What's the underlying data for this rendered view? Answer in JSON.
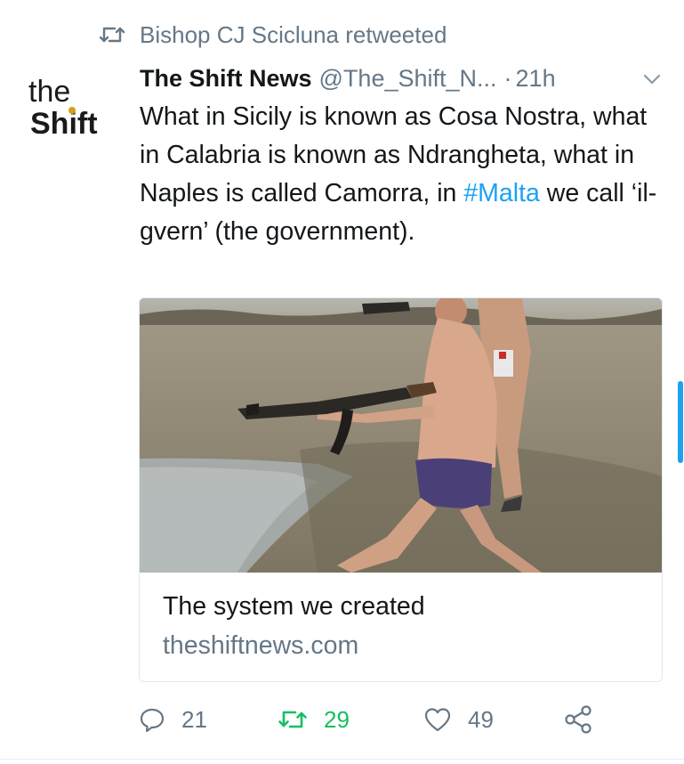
{
  "retweet_context": {
    "text": "Bishop CJ Scicluna retweeted"
  },
  "author": {
    "name": "The Shift News",
    "handle": "@The_Shift_N...",
    "separator": "·",
    "time": "21h",
    "avatar_text_line1": "the",
    "avatar_text_line2": "Shift"
  },
  "tweet": {
    "text_before": "What in Sicily is known as Cosa Nostra, what in Calabria is known as Ndrangheta, what in Naples is called Camorra, in ",
    "hashtag": "#Malta",
    "text_after": " we call ‘il-gvern’ (the government)."
  },
  "card": {
    "title": "The system we created",
    "domain": "theshiftnews.com"
  },
  "actions": {
    "reply_count": "21",
    "retweet_count": "29",
    "like_count": "49"
  },
  "colors": {
    "link_blue": "#1da1f2",
    "retweet_green": "#17bf63",
    "meta_gray": "#657786",
    "text": "#14171a"
  },
  "icons": [
    "retweet-icon",
    "caret-down-icon",
    "reply-icon",
    "retweet-icon",
    "like-icon",
    "share-icon"
  ]
}
